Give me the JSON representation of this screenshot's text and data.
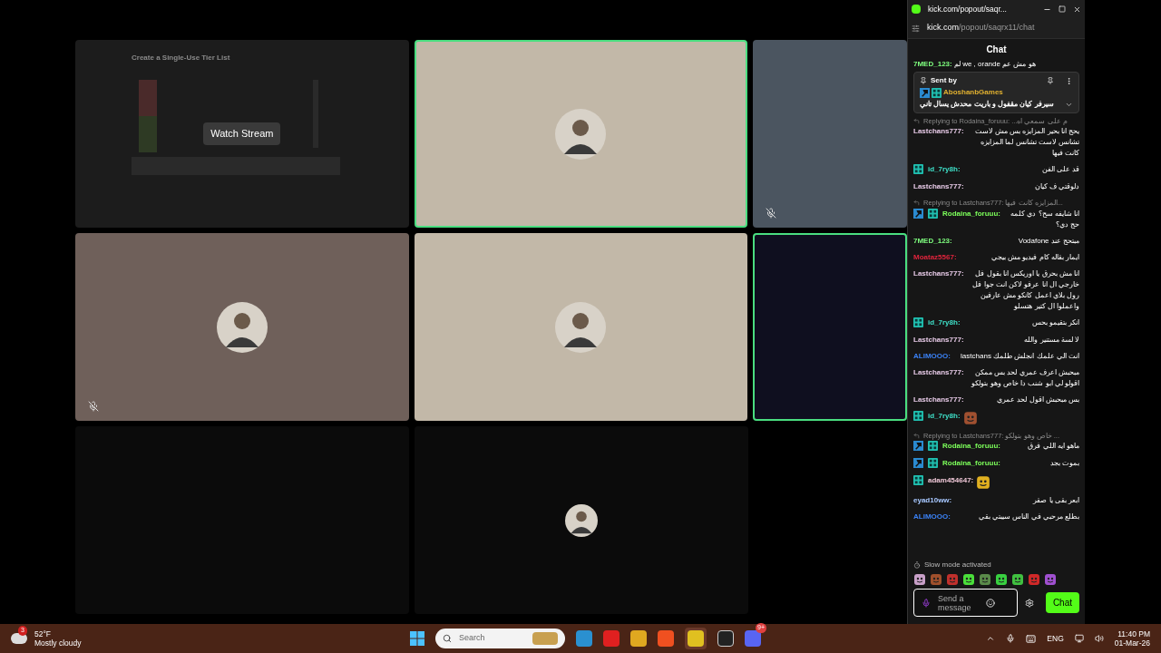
{
  "call_grid": {
    "tiles": [
      {
        "kind": "screen",
        "speaking": false,
        "muted": false,
        "color": "#1c1c1c",
        "page_title": "Create a Single-Use Tier List",
        "button": "Watch Stream"
      },
      {
        "kind": "avatar",
        "speaking": true,
        "muted": false,
        "color": "#c2b8a8"
      },
      {
        "kind": "avatar_cut",
        "speaking": false,
        "muted": true,
        "color": "#4b5560"
      },
      {
        "kind": "avatar",
        "speaking": false,
        "muted": true,
        "color": "#6f605a"
      },
      {
        "kind": "avatar",
        "speaking": false,
        "muted": false,
        "color": "#c2b8a8"
      },
      {
        "kind": "avatar_cut",
        "speaking": true,
        "muted": false,
        "color": "#0f0f1f"
      },
      {
        "kind": "empty",
        "speaking": false,
        "muted": false,
        "color": "#0b0b0b"
      },
      {
        "kind": "avatar_small",
        "speaking": false,
        "muted": false,
        "color": "#0b0b0b"
      }
    ]
  },
  "browser": {
    "title": "kick.com/popout/saqr...",
    "url_host": "kick.com",
    "url_path": "/popout/saqrx11/chat"
  },
  "chat": {
    "header": "Chat",
    "top_message": {
      "user": "7MED_123:",
      "color": "#7fff7f",
      "text": "لم we , orande هو مش عم"
    },
    "pinned": {
      "label": "Sent by",
      "user": "AboshanbGames",
      "badges": [
        {
          "kind": "mod"
        },
        {
          "kind": "og"
        }
      ],
      "text": "سيرفر كيان مقفول و باريت محدش يسال تاني"
    },
    "messages": [
      {
        "kind": "text",
        "reply": "Replying to Rodaina_foruuu: ...م على سمعي اه",
        "user": "Lastchans777:",
        "color": "#e6c9e6",
        "text": "يحج انا بحير المزايزه بس مش لاست تشانس لاست تشانس لما المزايزه كانت فيها"
      },
      {
        "kind": "text",
        "user": "id_7ry8h:",
        "color": "#3ee0c8",
        "badges": [
          {
            "kind": "og"
          }
        ],
        "text": "قد على الفن"
      },
      {
        "kind": "text",
        "user": "Lastchans777:",
        "color": "#e6c9e6",
        "text": "دلوقتي ف كيان"
      },
      {
        "kind": "text",
        "reply": "Replying to Lastchans777: المزايزه كانت فيها...",
        "user": "Rodaina_foruuu:",
        "color": "#7cff5a",
        "badges": [
          {
            "kind": "mod"
          },
          {
            "kind": "og"
          }
        ],
        "text": "انا شايفه سح؟ دي كلمه حج دي؟"
      },
      {
        "kind": "text",
        "user": "7MED_123:",
        "color": "#7fff7f",
        "text": "مبتحج عند Vodafone"
      },
      {
        "kind": "text",
        "user": "Moataz5567:",
        "color": "#e0243c",
        "text": "ايمار بقاله كام فيديو مش بيجي"
      },
      {
        "kind": "text",
        "user": "Lastchans777:",
        "color": "#e6c9e6",
        "text": "انا مش بحرق يا اوريكس انا بقول فل خارجي ال انا عرفو لاكن انت جوا فل رول بلاي اعمل كانكو مش عارفين واعملوا ال كتير هتسلو"
      },
      {
        "kind": "text",
        "user": "id_7ry8h:",
        "color": "#3ee0c8",
        "badges": [
          {
            "kind": "og"
          }
        ],
        "text": "انكر بتقيمو بحس"
      },
      {
        "kind": "text",
        "user": "Lastchans777:",
        "color": "#e6c9e6",
        "text": "لا لسة مستنير والله"
      },
      {
        "kind": "text",
        "user": "ALIMOOO:",
        "color": "#3b82f6",
        "text": "انت الي علمك انجلش طلمك lastchans"
      },
      {
        "kind": "text",
        "user": "Lastchans777:",
        "color": "#e6c9e6",
        "text": "مبحبش اعرف عمري لحد بس ممكن اقولو لي ابو شنب دا خاص وهو بتولكو"
      },
      {
        "kind": "text",
        "user": "Lastchans777:",
        "color": "#e6c9e6",
        "text": "بس مبحبش اقول لحد عمري"
      },
      {
        "kind": "emote",
        "user": "id_7ry8h:",
        "color": "#3ee0c8",
        "badges": [
          {
            "kind": "og"
          }
        ]
      },
      {
        "kind": "text",
        "reply": "Replying to Lastchans777: خاص وهو بتولكو ...",
        "user": "Rodaina_foruuu:",
        "color": "#7cff5a",
        "badges": [
          {
            "kind": "mod"
          },
          {
            "kind": "og"
          }
        ],
        "text": "ماهو ايه اللي فرق"
      },
      {
        "kind": "text",
        "user": "Rodaina_foruuu:",
        "color": "#7cff5a",
        "badges": [
          {
            "kind": "mod"
          },
          {
            "kind": "og"
          }
        ],
        "text": "بموت بجد"
      },
      {
        "kind": "emote",
        "user": "adam454647:",
        "color": "#f0c8d8",
        "badges": [
          {
            "kind": "og"
          }
        ]
      },
      {
        "kind": "text",
        "user": "eyad10ww:",
        "color": "#a8c8ff",
        "text": "ابعر بقى يا صقر"
      },
      {
        "kind": "text",
        "user": "ALIMOOO:",
        "color": "#3b82f6",
        "text": "بطلع مرحبي في الناس سيبتي بقي"
      }
    ],
    "slow_mode": "Slow mode activated",
    "input_placeholder": "Send a message",
    "send_button": "Chat"
  },
  "taskbar": {
    "weather": {
      "temp": "52°F",
      "condition": "Mostly cloudy",
      "badge": "3"
    },
    "search": "Search",
    "discord_badge": "9+",
    "language": "ENG",
    "time": "11:40 PM",
    "date": "01-Mar-26"
  }
}
